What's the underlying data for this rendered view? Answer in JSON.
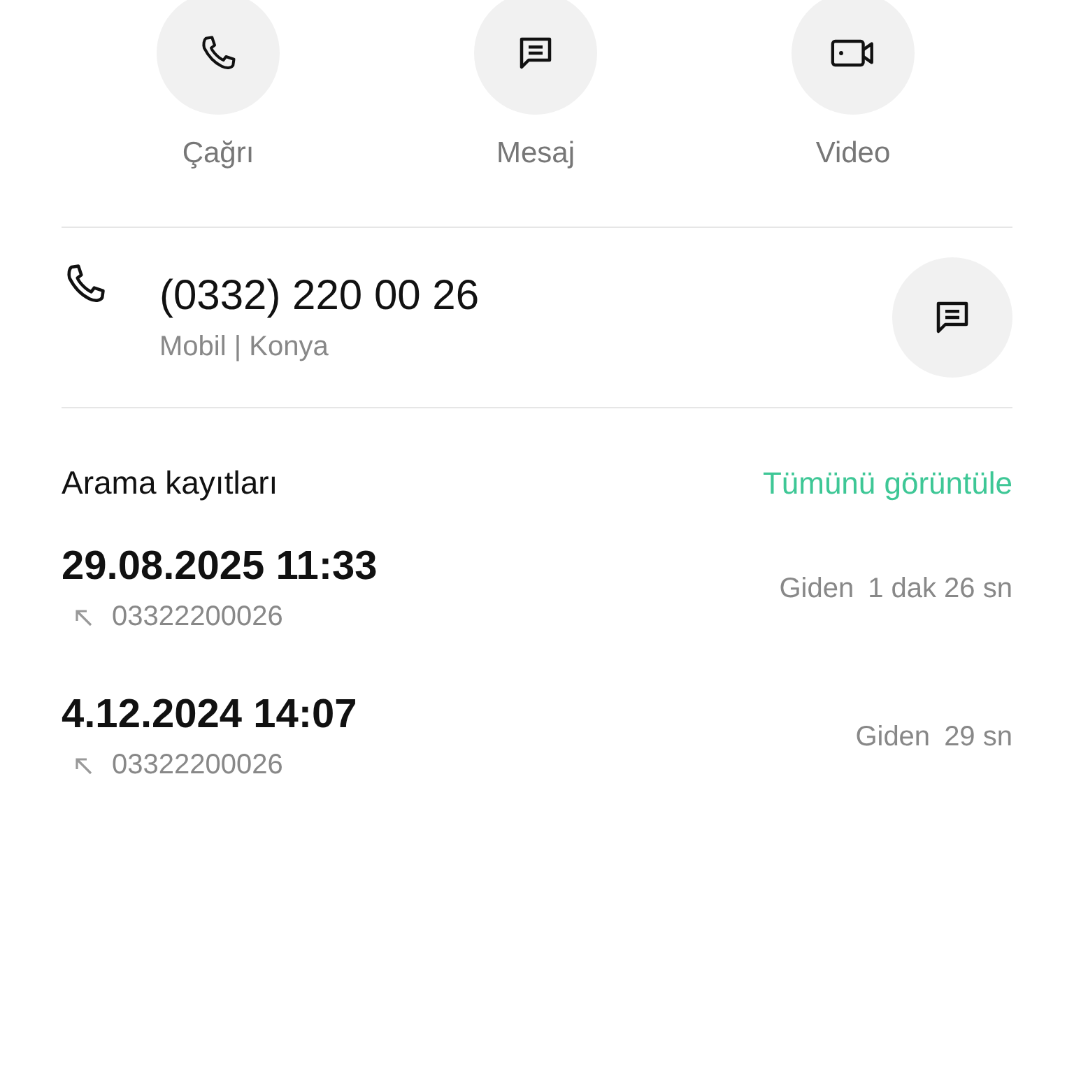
{
  "actions": [
    {
      "kind": "call",
      "label": "Çağrı"
    },
    {
      "kind": "message",
      "label": "Mesaj"
    },
    {
      "kind": "video",
      "label": "Video"
    }
  ],
  "number": {
    "value": "(0332) 220 00 26",
    "detail": "Mobil | Konya"
  },
  "call_log": {
    "title": "Arama kayıtları",
    "link": "Tümünü görüntüle",
    "entries": [
      {
        "datetime": "29.08.2025 11:33",
        "kind": "outgoing",
        "number": "03322200026",
        "type": "Giden",
        "duration": "1 dak 26 sn"
      },
      {
        "datetime": "4.12.2024 14:07",
        "kind": "outgoing",
        "number": "03322200026",
        "type": "Giden",
        "duration": "29 sn"
      }
    ]
  }
}
